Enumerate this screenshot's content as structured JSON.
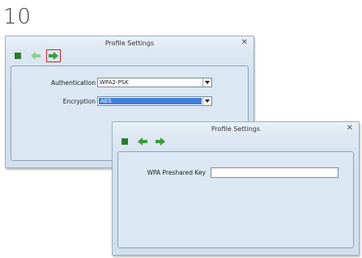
{
  "step": {
    "number": "10"
  },
  "window1": {
    "title": "Profile Settings",
    "close": "✕",
    "toolbar": [
      "stop",
      "back",
      "next"
    ],
    "authentication": {
      "label": "Authentication",
      "value": "WPA2-PSK"
    },
    "encryption": {
      "label": "Encryption",
      "value": "AES"
    }
  },
  "window2": {
    "title": "Profile Settings",
    "close": "✕",
    "toolbar": [
      "stop",
      "back",
      "next"
    ],
    "wpa_key": {
      "label": "WPA Preshared Key",
      "value": ""
    }
  },
  "colors": {
    "icon_green": "#3b9b3b",
    "icon_dark_green": "#2f7a2f",
    "highlight_red": "#d2202a",
    "selection_blue": "#3d7ed8"
  }
}
